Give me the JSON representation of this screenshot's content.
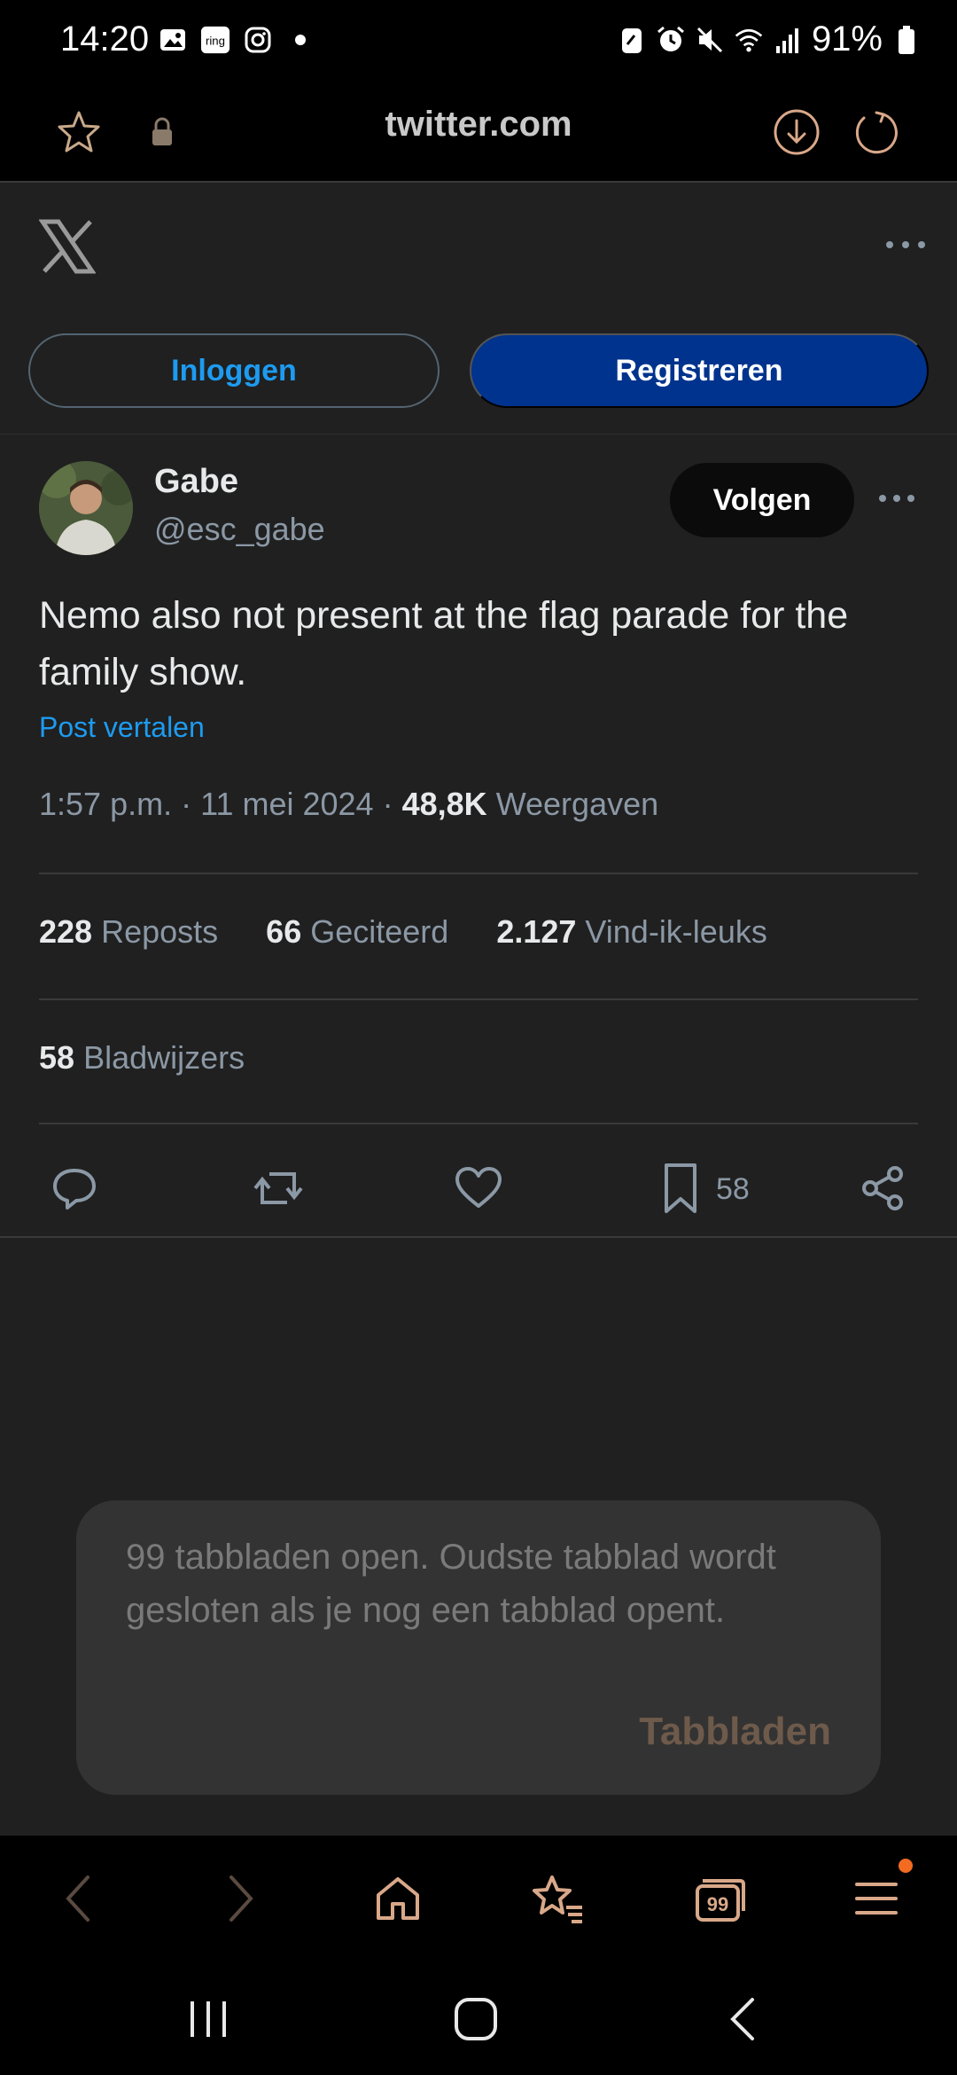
{
  "status_bar": {
    "time": "14:20",
    "battery": "91%",
    "left_icons": [
      "gallery-icon",
      "ring-icon",
      "instagram-icon",
      "dot-icon"
    ],
    "right_icons": [
      "battery-saver-icon",
      "alarm-icon",
      "mute-icon",
      "wifi-icon",
      "signal-icon",
      "battery-icon"
    ],
    "ring_label": "ring"
  },
  "browser": {
    "url": "twitter.com"
  },
  "header": {
    "login_label": "Inloggen",
    "register_label": "Registreren"
  },
  "tweet": {
    "author_name": "Gabe",
    "author_handle": "@esc_gabe",
    "follow_label": "Volgen",
    "text": "Nemo also not present at the flag parade for the family show.",
    "translate_label": "Post vertalen",
    "time": "1:57 p.m.",
    "date": "11 mei 2024",
    "views_count": "48,8K",
    "views_label": "Weergaven",
    "reposts_count": "228",
    "reposts_label": "Reposts",
    "quotes_count": "66",
    "quotes_label": "Geciteerd",
    "likes_count": "2.127",
    "likes_label": "Vind-ik-leuks",
    "bookmarks_count": "58",
    "bookmarks_label": "Bladwijzers",
    "bookmark_action_count": "58"
  },
  "toast": {
    "message": "99 tabbladen open. Oudste tabblad wordt gesloten als je nog een tabblad opent.",
    "action_label": "Tabbladen"
  },
  "toolbar": {
    "tabs_count": "99"
  },
  "colors": {
    "accent_blue": "#1d9bf0",
    "register_bg": "#00338d",
    "badge_orange": "#f36b21"
  }
}
